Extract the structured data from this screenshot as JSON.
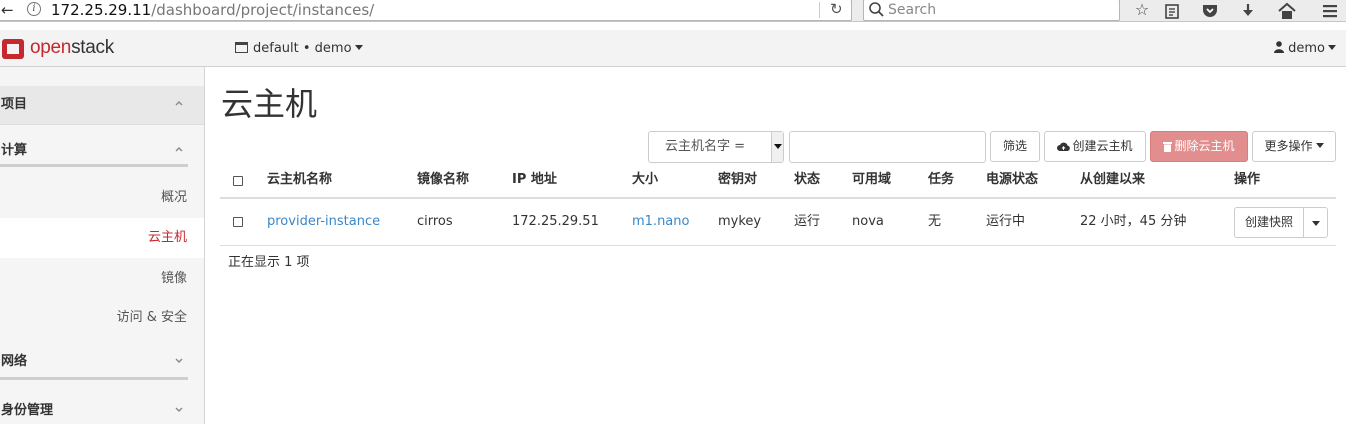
{
  "browser": {
    "url_host": "172.25.29.11",
    "url_path": "/dashboard/project/instances/",
    "search_placeholder": "Search"
  },
  "header": {
    "logo_open": "open",
    "logo_stack": "stack",
    "project_selector": "default • demo",
    "user": "demo"
  },
  "sidebar": {
    "sections": [
      {
        "label": "项目"
      },
      {
        "label": "计算"
      },
      {
        "label": "网络"
      },
      {
        "label": "身份管理"
      }
    ],
    "items": [
      {
        "label": "概况"
      },
      {
        "label": "云主机"
      },
      {
        "label": "镜像"
      },
      {
        "label": "访问 & 安全"
      }
    ]
  },
  "main": {
    "title": "云主机",
    "filter_select": "云主机名字 =",
    "filter_input_value": "",
    "buttons": {
      "filter": "筛选",
      "create": "创建云主机",
      "delete": "删除云主机",
      "more": "更多操作"
    },
    "columns": [
      "云主机名称",
      "镜像名称",
      "IP 地址",
      "大小",
      "密钥对",
      "状态",
      "可用域",
      "任务",
      "电源状态",
      "从创建以来",
      "操作"
    ],
    "rows": [
      {
        "name": "provider-instance",
        "image": "cirros",
        "ip": "172.25.29.51",
        "size": "m1.nano",
        "keypair": "mykey",
        "status": "运行",
        "zone": "nova",
        "task": "无",
        "power": "运行中",
        "age": "22 小时，45 分钟",
        "action": "创建快照"
      }
    ],
    "count_text": "正在显示 1 项"
  },
  "colors": {
    "brand_red": "#c5282e",
    "link_blue": "#3a87c8",
    "danger_button": "#e28e8e"
  }
}
